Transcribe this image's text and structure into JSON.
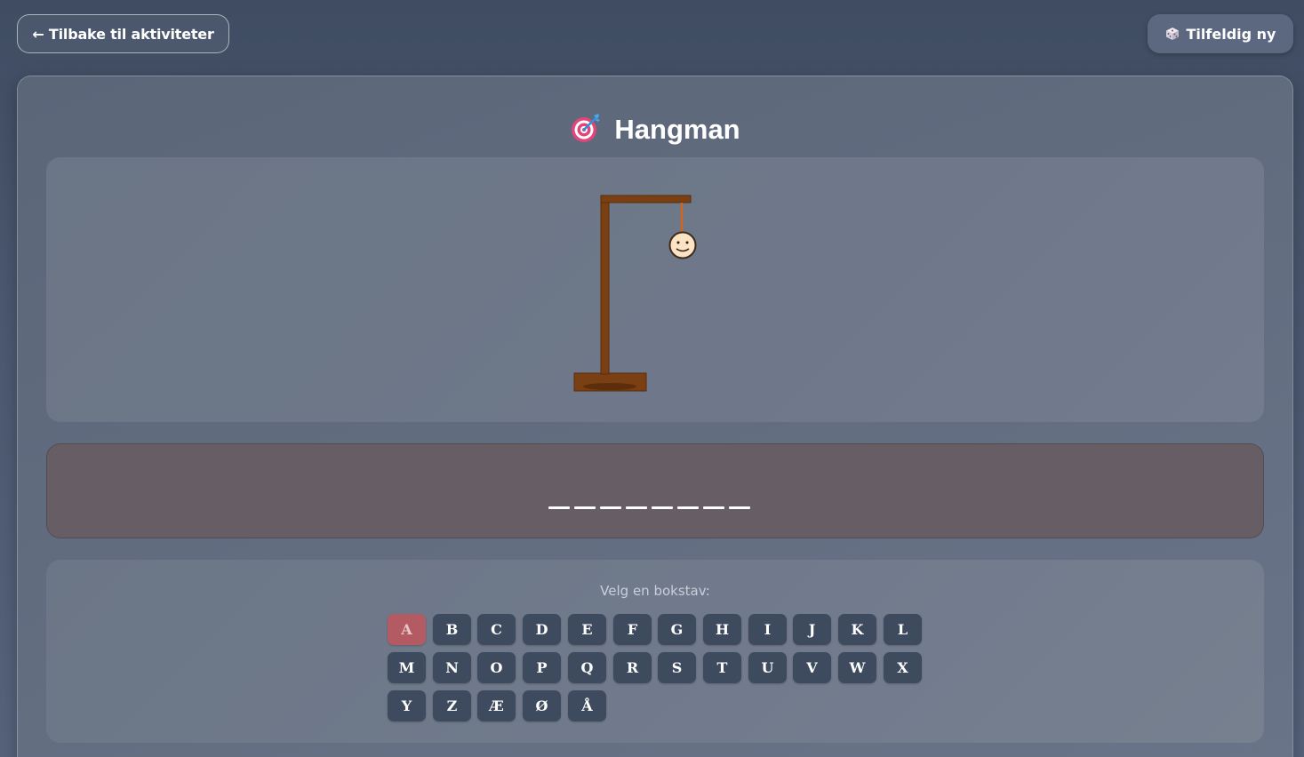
{
  "header": {
    "back_label": "← Tilbake til aktiviteter",
    "random_label": "Tilfeldig ny",
    "random_icon": "dice-icon"
  },
  "game": {
    "title": "Hangman",
    "title_icon": "target-icon",
    "word_length": 8,
    "prompt": "Velg en bokstav:",
    "guessed_wrong": [
      "A"
    ],
    "rows": [
      [
        "A",
        "B",
        "C",
        "D",
        "E",
        "F",
        "G",
        "H",
        "I",
        "J",
        "K",
        "L"
      ],
      [
        "M",
        "N",
        "O",
        "P",
        "Q",
        "R",
        "S",
        "T",
        "U",
        "V",
        "W",
        "X"
      ],
      [
        "Y",
        "Z",
        "Æ",
        "Ø",
        "Å"
      ]
    ]
  },
  "colors": {
    "wood": "#7a3f12",
    "wrong_key": "#b35a62",
    "key": "#3e4b5f"
  }
}
